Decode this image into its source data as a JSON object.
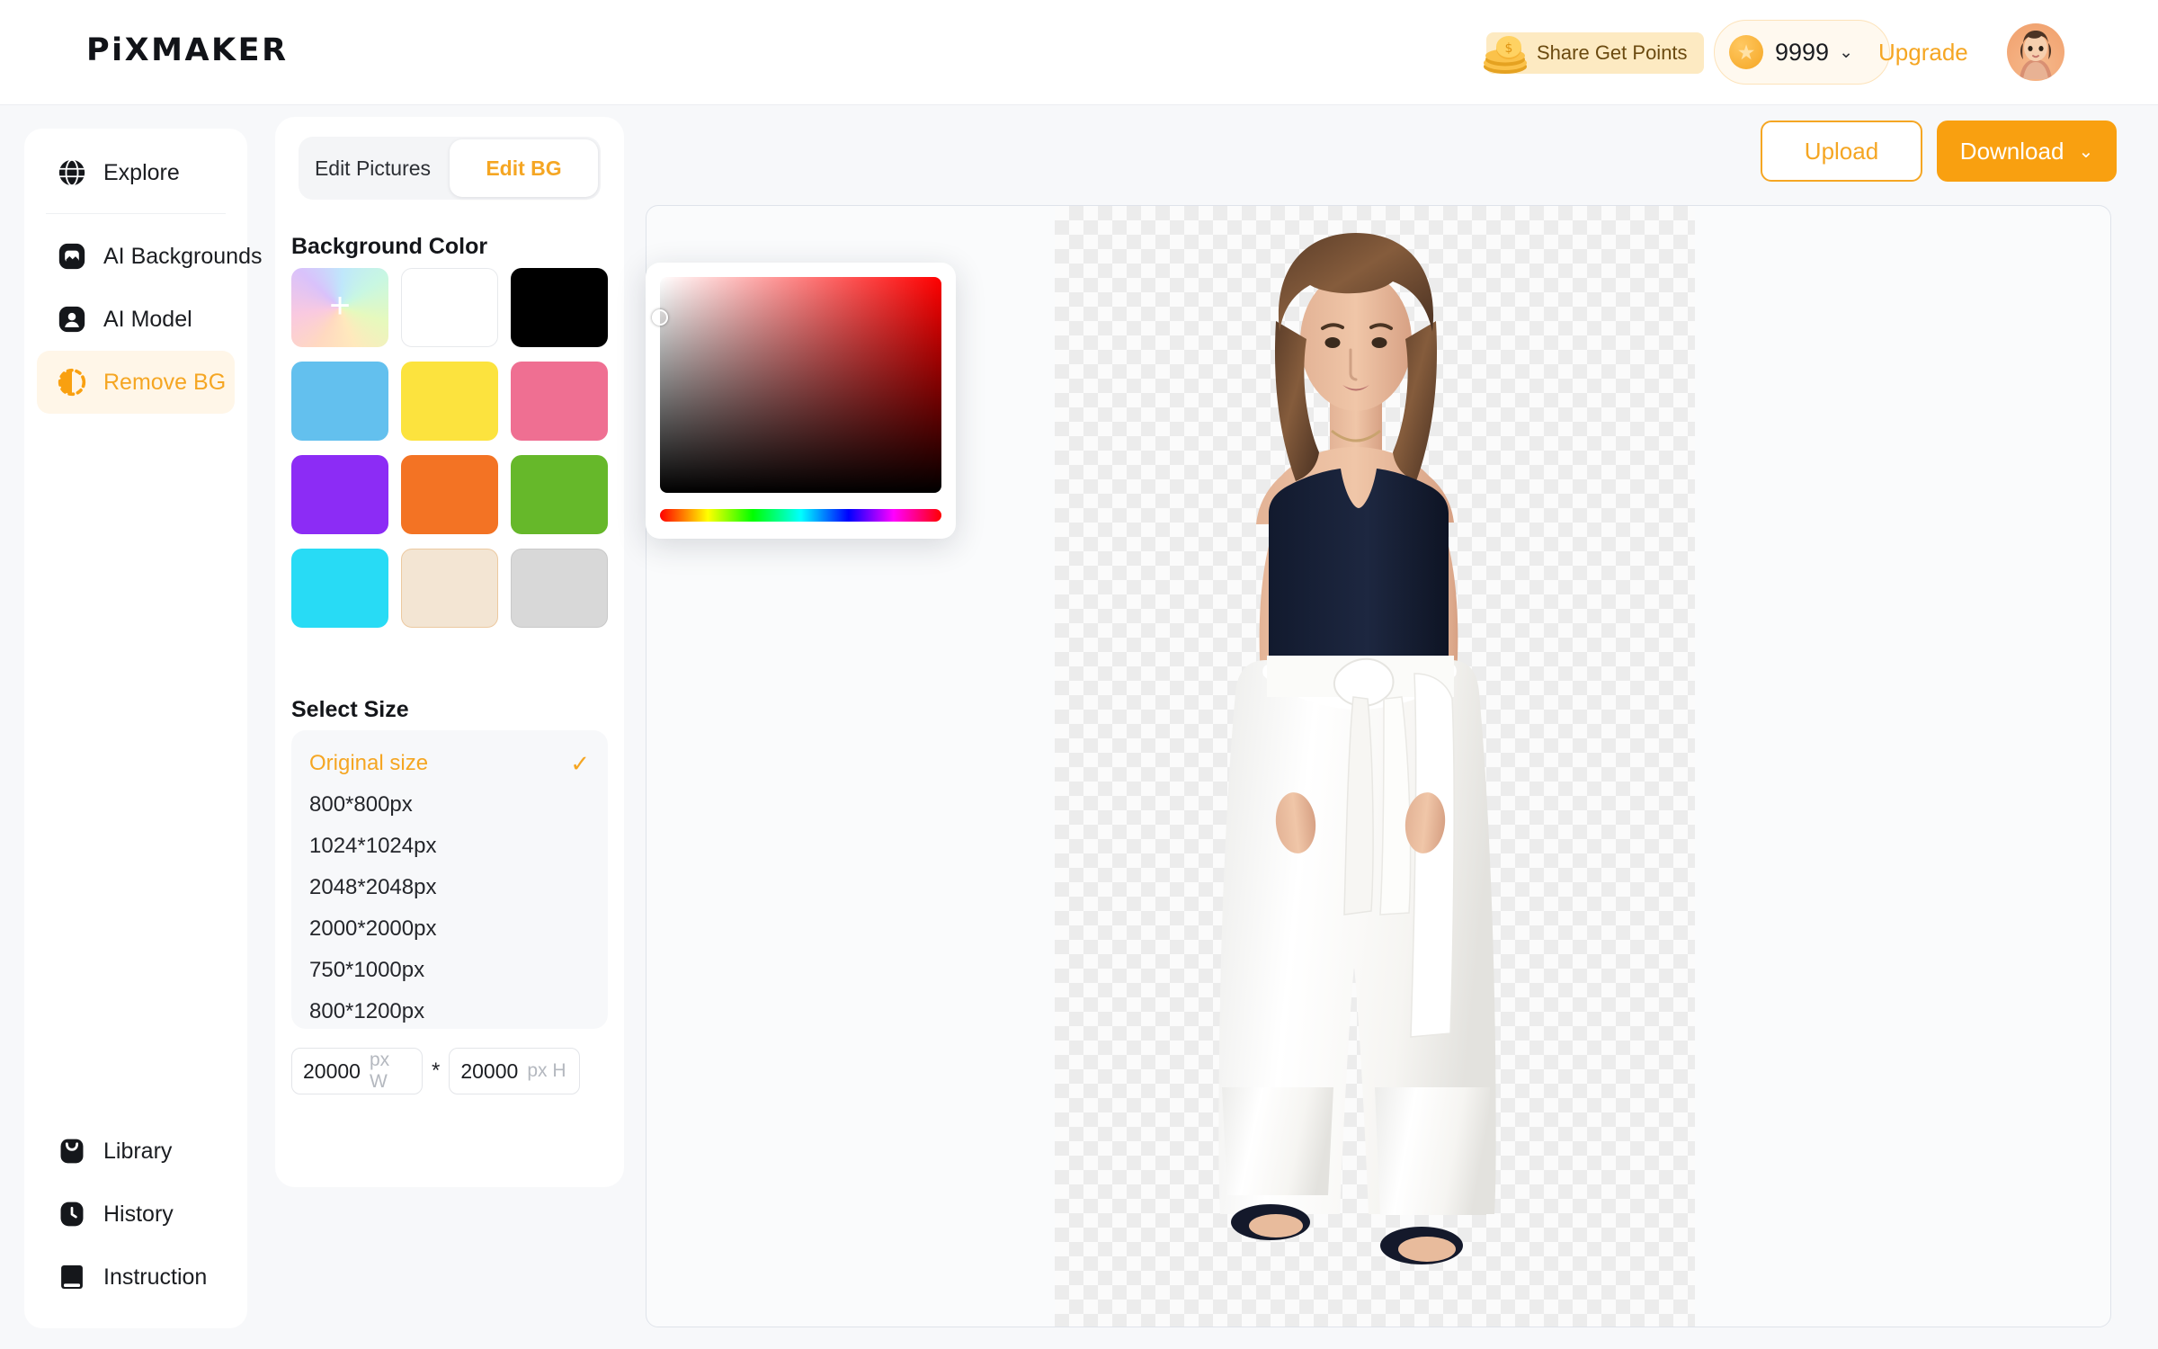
{
  "header": {
    "logo": "PiXMAKER",
    "share_points_label": "Share Get Points",
    "coins_icon": "coins-icon",
    "coin_star_icon": "star-coin-icon",
    "credits_value": "9999",
    "credits_caret": "⌄",
    "upgrade_label": "Upgrade",
    "avatar": "user-avatar"
  },
  "sidebar": {
    "top_items": [
      {
        "label": "Explore",
        "icon": "globe-icon"
      }
    ],
    "items": [
      {
        "label": "AI Backgrounds",
        "icon": "image-icon"
      },
      {
        "label": "AI Model",
        "icon": "person-icon"
      },
      {
        "label": "Remove BG",
        "icon": "remove-bg-icon",
        "active": true
      }
    ],
    "bottom_items": [
      {
        "label": "Library",
        "icon": "library-icon"
      },
      {
        "label": "History",
        "icon": "clock-icon"
      },
      {
        "label": "Instruction",
        "icon": "book-icon"
      }
    ]
  },
  "panel": {
    "tabs": [
      {
        "label": "Edit Pictures",
        "active": false
      },
      {
        "label": "Edit BG",
        "active": true
      }
    ],
    "background_color_title": "Background Color",
    "swatches": [
      {
        "name": "custom-color",
        "color": "gradient",
        "plus": "+"
      },
      {
        "name": "white",
        "color": "#ffffff"
      },
      {
        "name": "black",
        "color": "#000000"
      },
      {
        "name": "sky-blue",
        "color": "#63c0ee"
      },
      {
        "name": "yellow",
        "color": "#fce33e"
      },
      {
        "name": "pink",
        "color": "#ef6f92"
      },
      {
        "name": "purple",
        "color": "#8c2cf5"
      },
      {
        "name": "orange",
        "color": "#f37324"
      },
      {
        "name": "green",
        "color": "#66b82a"
      },
      {
        "name": "cyan",
        "color": "#28dbf5"
      },
      {
        "name": "cream",
        "color": "#f3e5d3"
      },
      {
        "name": "light-gray",
        "color": "#d8d8d8"
      }
    ],
    "select_size_title": "Select Size",
    "sizes": [
      {
        "label": "Original size",
        "selected": true,
        "check": "✓"
      },
      {
        "label": "800*800px",
        "selected": false
      },
      {
        "label": "1024*1024px",
        "selected": false
      },
      {
        "label": "2048*2048px",
        "selected": false
      },
      {
        "label": "2000*2000px",
        "selected": false
      },
      {
        "label": "750*1000px",
        "selected": false
      },
      {
        "label": "800*1200px",
        "selected": false
      }
    ],
    "custom_size": {
      "width_value": "20000",
      "width_unit": "px W",
      "separator": "*",
      "height_value": "20000",
      "height_unit": "px H"
    }
  },
  "toolbar": {
    "upload_label": "Upload",
    "download_label": "Download",
    "download_caret": "⌄"
  },
  "canvas": {
    "artboard_name": "transparent-artboard",
    "subject": "woman-in-navy-top-and-white-trousers"
  },
  "color_picker": {
    "name": "color-picker-popup",
    "hue": "#ff0000",
    "sv_handle": "saturation-value-handle"
  },
  "colors": {
    "accent": "#f5a623",
    "accent_strong": "#f9a010",
    "accent_soft": "#fff6e8",
    "page_bg": "#f7f8fa",
    "text": "#1b1d21"
  }
}
